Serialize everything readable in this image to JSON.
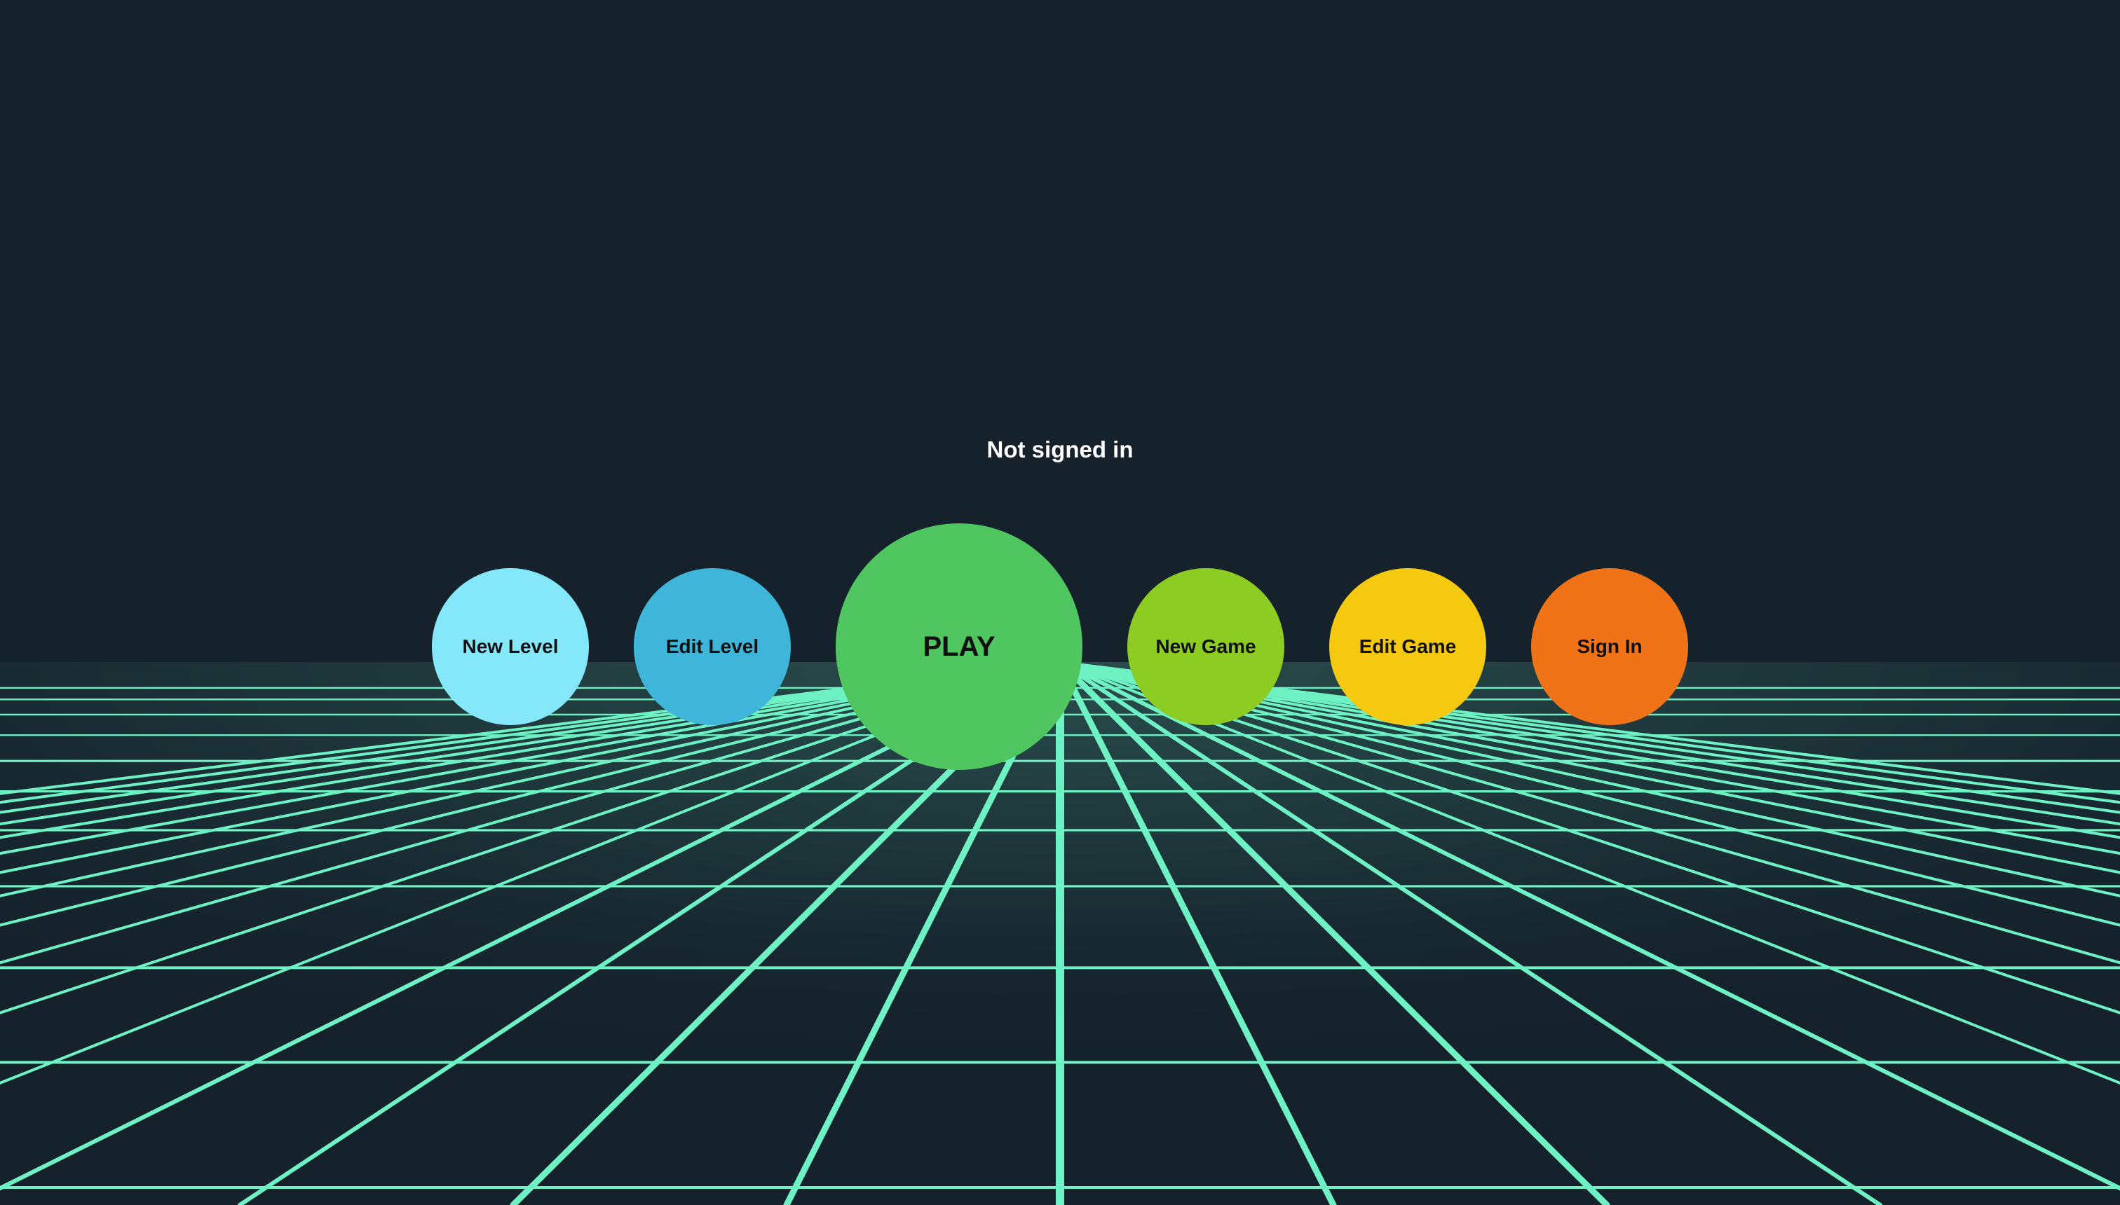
{
  "status": {
    "text": "Not signed in"
  },
  "menu": {
    "new_level": "New Level",
    "edit_level": "Edit Level",
    "play": "PLAY",
    "new_game": "New Game",
    "edit_game": "Edit Game",
    "sign_in": "Sign In"
  },
  "colors": {
    "background": "#15212b",
    "grid_line": "#6ef2c4",
    "new_level": "#84e8fa",
    "edit_level": "#3fb6d9",
    "play": "#4fc660",
    "new_game": "#8dcc22",
    "edit_game": "#f5c90f",
    "sign_in": "#f07317"
  }
}
